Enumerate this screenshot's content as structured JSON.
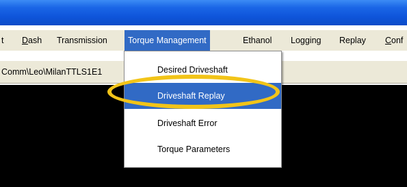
{
  "menubar": {
    "items": [
      {
        "label": "t",
        "underline": ""
      },
      {
        "label": "ash",
        "underline": "D"
      },
      {
        "label": "Transmission",
        "underline": ""
      },
      {
        "label": "Torque Management",
        "underline": ""
      },
      {
        "label": "Ethanol",
        "underline": ""
      },
      {
        "label": "Logging",
        "underline": ""
      },
      {
        "label": "Replay",
        "underline": ""
      },
      {
        "label": "onf",
        "underline": "C"
      }
    ]
  },
  "pathbar": {
    "text": "Comm\\Leo\\MilanTTLS1E1"
  },
  "dropdown": {
    "items": [
      {
        "label": "Desired Driveshaft"
      },
      {
        "label": "Driveshaft Replay"
      },
      {
        "label": "Driveshaft Error"
      },
      {
        "label": "Torque Parameters"
      }
    ],
    "selected_index": 1
  },
  "colors": {
    "titlebar": "#0b4cc8",
    "selection": "#316ac5",
    "highlight_ring": "#f2c418"
  }
}
